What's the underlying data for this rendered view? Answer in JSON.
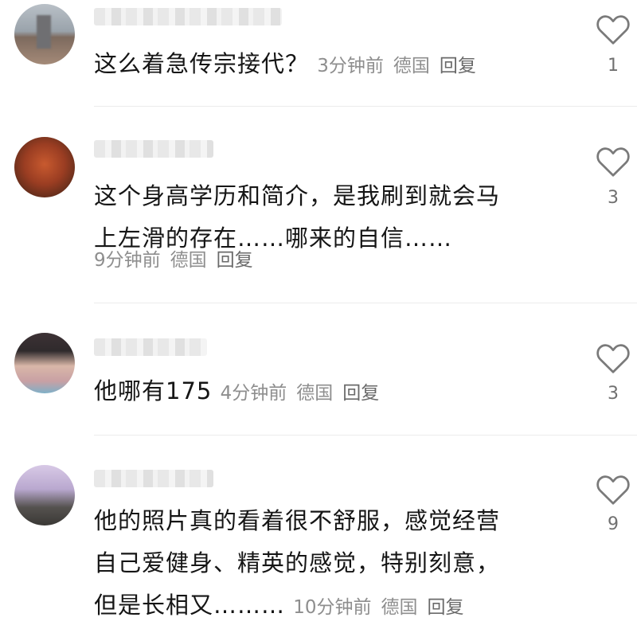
{
  "comments": [
    {
      "text": "这么着急传宗接代？",
      "time": "3分钟前",
      "location": "德国",
      "reply": "回复",
      "likes": "1"
    },
    {
      "text_line1": "这个身高学历和简介，是我刷到就会马",
      "text_line2": "上左滑的存在……哪来的自信……",
      "time": "9分钟前",
      "location": "德国",
      "reply": "回复",
      "likes": "3"
    },
    {
      "text": "他哪有175",
      "time": "4分钟前",
      "location": "德国",
      "reply": "回复",
      "likes": "3"
    },
    {
      "text_line1": "他的照片真的看着很不舒服，感觉经营",
      "text_line2": "自己爱健身、精英的感觉，特别刻意，",
      "text_line3": "但是长相又………",
      "time": "10分钟前",
      "location": "德国",
      "reply": "回复",
      "likes": "9"
    }
  ],
  "icons": {
    "like": "heart-outline-icon"
  },
  "colors": {
    "text": "#151515",
    "meta": "#8e8e8e",
    "divider": "#ececec"
  }
}
